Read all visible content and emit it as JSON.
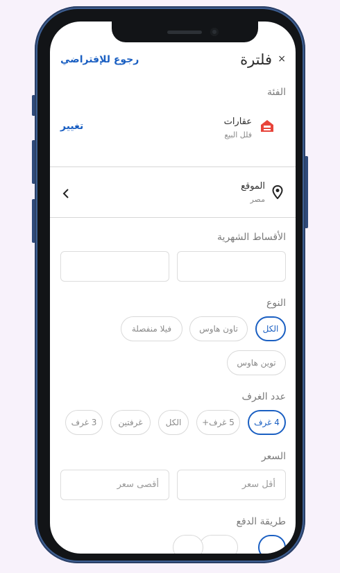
{
  "header": {
    "title": "فلترة",
    "close_icon": "×",
    "reset_label": "رجوع للإفتراضي"
  },
  "category": {
    "section_label": "الفئة",
    "name": "عقارات",
    "subname": "فلل البيع",
    "change_label": "تغيير",
    "icon": "real-estate-icon",
    "icon_color": "#e8443a"
  },
  "location": {
    "label": "الموقع",
    "value": "مصر",
    "icon": "location-pin-icon"
  },
  "installments": {
    "label": "الأقساط الشهرية",
    "from_value": "",
    "to_value": ""
  },
  "type": {
    "label": "النوع",
    "options": [
      "الكل",
      "تاون هاوس",
      "فيلا منفصلة",
      "توين هاوس"
    ],
    "selected": "الكل"
  },
  "rooms": {
    "label": "عدد الغرف",
    "options": [
      "4 غرف",
      "5 غرف+",
      "الكل",
      "غرفتين",
      "3 غرف"
    ],
    "selected": "4 غرف"
  },
  "price": {
    "label": "السعر",
    "min_placeholder": "أقل سعر",
    "max_placeholder": "أقصى سعر"
  },
  "payment": {
    "label": "طريقة الدفع"
  },
  "colors": {
    "accent": "#1a5fc2",
    "frame": "#3e5f92",
    "background": "#f8f2fb"
  }
}
